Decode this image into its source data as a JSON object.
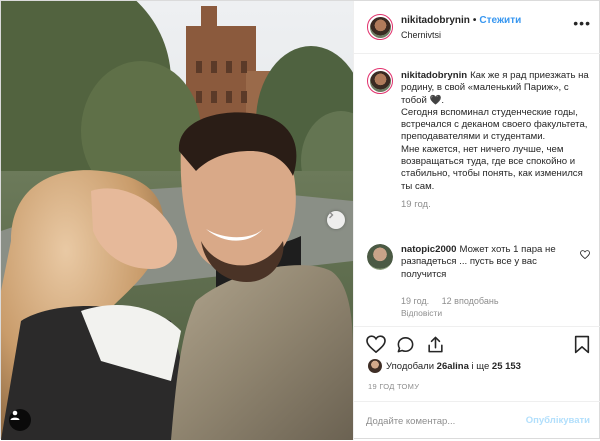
{
  "post": {
    "username": "nikitadobrynin",
    "follow_label": "Стежити",
    "location": "Chernivtsi",
    "more_label": "•••"
  },
  "caption": {
    "username": "nikitadobrynin",
    "lines": [
      "Как же я рад приезжать на родину, в свой «маленький Париж», с тобой 🖤.",
      "Сегодня вспоминал студенческие годы, встречался с деканом своего факультета, преподавателями и студентами.",
      "Мне кажется, нет ничего лучше, чем возвращаться туда, где все спокойно и стабильно, чтобы понять, как изменился ты сам."
    ],
    "time": "19 год."
  },
  "comment": {
    "username": "natopic2000",
    "text": "Может хоть 1 пара не разпадеться ... пусть все у вас получится",
    "time": "19 год.",
    "likes": "12 вподобань",
    "reply_label": "Відповісти"
  },
  "likes": {
    "prefix": "Уподобали",
    "user": "26alina",
    "middle": "і ще",
    "count": "25 153"
  },
  "post_time": "19 ГОД ТОМУ",
  "add_comment": {
    "placeholder": "Додайте коментар...",
    "publish_label": "Опублікувати"
  },
  "colors": {
    "link_blue": "#3897f0",
    "publish_disabled": "#b2dffc",
    "muted": "#8e8e8e",
    "text": "#262626"
  }
}
